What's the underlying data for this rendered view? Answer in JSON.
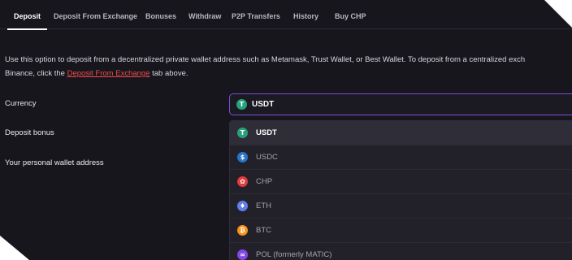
{
  "tabs": [
    {
      "label": "Deposit",
      "active": true
    },
    {
      "label": "Deposit From Exchange",
      "active": false
    },
    {
      "label": "Bonuses",
      "active": false
    },
    {
      "label": "Withdraw",
      "active": false
    },
    {
      "label": "P2P Transfers",
      "active": false
    },
    {
      "label": "History",
      "active": false
    },
    {
      "label": "Buy CHP",
      "active": false
    }
  ],
  "intro": {
    "line1": "Use this option to deposit from a decentralized private wallet address such as Metamask, Trust Wallet, or Best Wallet. To deposit from a centralized exch",
    "line2_before": "Binance, click the ",
    "link": "Deposit From Exchange",
    "line2_after": " tab above."
  },
  "form": {
    "currency_label": "Currency",
    "bonus_label": "Deposit bonus",
    "wallet_label": "Your personal wallet address"
  },
  "currency_select": {
    "selected": "USDT",
    "options": [
      {
        "name": "USDT",
        "icon": "tether-icon",
        "color": "#26a17b",
        "selected": true
      },
      {
        "name": "USDC",
        "icon": "usdc-icon",
        "color": "#2775ca",
        "selected": false
      },
      {
        "name": "CHP",
        "icon": "chp-icon",
        "color": "#e23b3b",
        "selected": false
      },
      {
        "name": "ETH",
        "icon": "ethereum-icon",
        "color": "#627eea",
        "selected": false
      },
      {
        "name": "BTC",
        "icon": "bitcoin-icon",
        "color": "#f7931a",
        "selected": false
      },
      {
        "name": "POL (formerly MATIC)",
        "icon": "polygon-icon",
        "color": "#8247e5",
        "selected": false
      }
    ]
  }
}
